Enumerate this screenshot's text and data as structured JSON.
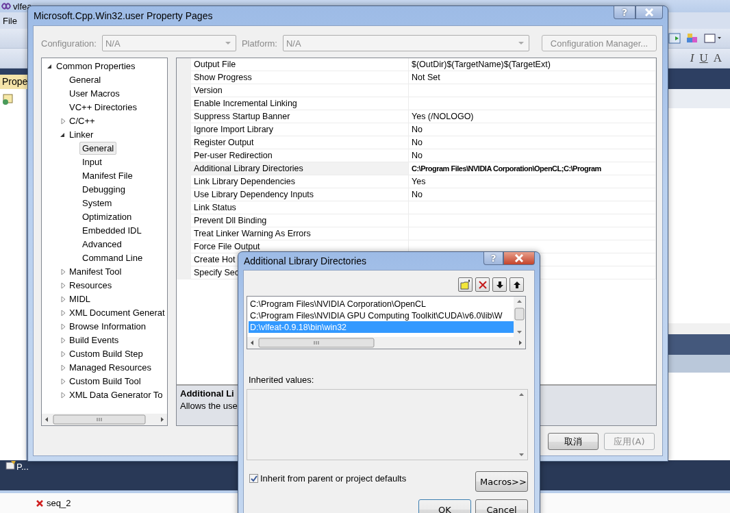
{
  "ide": {
    "title": "vlfea",
    "menu": [
      "File"
    ],
    "format_glyphs": [
      "I",
      "U",
      "A"
    ],
    "panel_tab": "Prope",
    "bottom_tab": "P...",
    "error_entry": "seq_2"
  },
  "property_pages": {
    "title": "Microsoft.Cpp.Win32.user Property Pages",
    "help_button": "?",
    "configuration": {
      "label": "Configuration:",
      "value": "N/A",
      "disabled": true
    },
    "platform": {
      "label": "Platform:",
      "value": "N/A",
      "disabled": true
    },
    "config_manager": {
      "label": "Configuration Manager...",
      "disabled": true
    },
    "tree": [
      {
        "label": "Common Properties",
        "expanded": true,
        "selected": false,
        "children": [
          {
            "label": "General",
            "selected": false
          },
          {
            "label": "User Macros",
            "selected": false
          },
          {
            "label": "VC++ Directories",
            "selected": false
          },
          {
            "label": "C/C++",
            "expanded": false,
            "selected": false
          },
          {
            "label": "Linker",
            "expanded": true,
            "selected": false,
            "children": [
              {
                "label": "General",
                "selected": true
              },
              {
                "label": "Input",
                "selected": false
              },
              {
                "label": "Manifest File",
                "selected": false
              },
              {
                "label": "Debugging",
                "selected": false
              },
              {
                "label": "System",
                "selected": false
              },
              {
                "label": "Optimization",
                "selected": false
              },
              {
                "label": "Embedded IDL",
                "selected": false
              },
              {
                "label": "Advanced",
                "selected": false
              },
              {
                "label": "Command Line",
                "selected": false
              }
            ]
          },
          {
            "label": "Manifest Tool",
            "expanded": false,
            "selected": false
          },
          {
            "label": "Resources",
            "expanded": false,
            "selected": false
          },
          {
            "label": "MIDL",
            "expanded": false,
            "selected": false
          },
          {
            "label": "XML Document Generat",
            "expanded": false,
            "selected": false
          },
          {
            "label": "Browse Information",
            "expanded": false,
            "selected": false
          },
          {
            "label": "Build Events",
            "expanded": false,
            "selected": false
          },
          {
            "label": "Custom Build Step",
            "expanded": false,
            "selected": false
          },
          {
            "label": "Managed Resources",
            "expanded": false,
            "selected": false
          },
          {
            "label": "Custom Build Tool",
            "expanded": false,
            "selected": false
          },
          {
            "label": "XML Data Generator To",
            "expanded": false,
            "selected": false
          }
        ]
      }
    ],
    "grid": [
      {
        "name": "Output File",
        "value": "$(OutDir)$(TargetName)$(TargetExt)",
        "selected": false
      },
      {
        "name": "Show Progress",
        "value": "Not Set",
        "selected": false
      },
      {
        "name": "Version",
        "selected": false
      },
      {
        "name": "Enable Incremental Linking",
        "selected": false
      },
      {
        "name": "Suppress Startup Banner",
        "value": "Yes (/NOLOGO)",
        "selected": false
      },
      {
        "name": "Ignore Import Library",
        "value": "No",
        "selected": false
      },
      {
        "name": "Register Output",
        "value": "No",
        "selected": false
      },
      {
        "name": "Per-user Redirection",
        "value": "No",
        "selected": false
      },
      {
        "name": "Additional Library Directories",
        "value": "C:\\Program Files\\NVIDIA Corporation\\OpenCL;C:\\Program",
        "selected": true
      },
      {
        "name": "Link Library Dependencies",
        "value": "Yes",
        "selected": false
      },
      {
        "name": "Use Library Dependency Inputs",
        "value": "No",
        "selected": false
      },
      {
        "name": "Link Status",
        "selected": false
      },
      {
        "name": "Prevent Dll Binding",
        "selected": false
      },
      {
        "name": "Treat Linker Warning As Errors",
        "selected": false
      },
      {
        "name": "Force File Output",
        "selected": false
      },
      {
        "name": "Create Hot",
        "selected": false
      },
      {
        "name": "Specify Sec",
        "selected": false
      }
    ],
    "description": {
      "title": "Additional Li",
      "text": "Allows the use"
    },
    "buttons": [
      {
        "label": "取消",
        "disabled": false
      },
      {
        "label": "应用(A)",
        "disabled": true
      }
    ]
  },
  "library_dialog": {
    "title": "Additional Library Directories",
    "help_button": "?",
    "entries": [
      {
        "text": "C:\\Program Files\\NVIDIA Corporation\\OpenCL",
        "selected": false
      },
      {
        "text": "C:\\Program Files\\NVIDIA GPU Computing Toolkit\\CUDA\\v6.0\\lib\\W",
        "selected": false
      },
      {
        "text": "D:\\vlfeat-0.9.18\\bin\\win32",
        "selected": true
      }
    ],
    "inherited_label": "Inherited values:",
    "inherit": {
      "label": "Inherit from parent or project defaults",
      "checked": true
    },
    "macros_button": "Macros>>",
    "buttons": [
      "OK",
      "Cancel"
    ]
  }
}
